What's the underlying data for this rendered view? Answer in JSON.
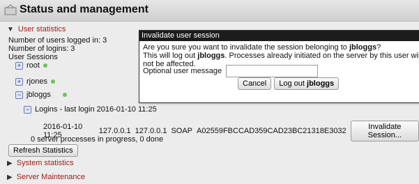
{
  "header": {
    "title": "Status and management",
    "icon": "app-icon"
  },
  "sections": {
    "user_statistics": "User statistics",
    "system_statistics": "System statistics",
    "server_maintenance": "Server Maintenance"
  },
  "stats": {
    "logged_in": "Number of users logged in: 3",
    "logins": "Number of logins: 3",
    "user_sessions": "User Sessions"
  },
  "users": [
    "root",
    "rjones",
    "jbloggs"
  ],
  "logins_row": {
    "label": "Logins - last login 2016-01-10 11:25"
  },
  "session": {
    "date": "2016-01-10 11:25",
    "ip1": "127.0.0.1",
    "ip2": "127.0.0.1",
    "protocol": "SOAP",
    "id": "A02559FBCCAD359CAD23BC21318E3032",
    "button": "Invalidate Session..."
  },
  "processes": "0 server processes in progress, 0 done",
  "refresh_button": "Refresh Statistics",
  "dialog": {
    "title": "Invalidate user session",
    "line1_pre": "Are you sure you want to invalidate the session belonging to ",
    "user": "jbloggs",
    "line1_post": "?",
    "line2_pre": "This will log out ",
    "line2_post": ". Processes already initiated on the server by this user will not be affected.",
    "optional_label": "Optional user message",
    "optional_value": "",
    "cancel": "Cancel",
    "logout_pre": "Log out "
  }
}
